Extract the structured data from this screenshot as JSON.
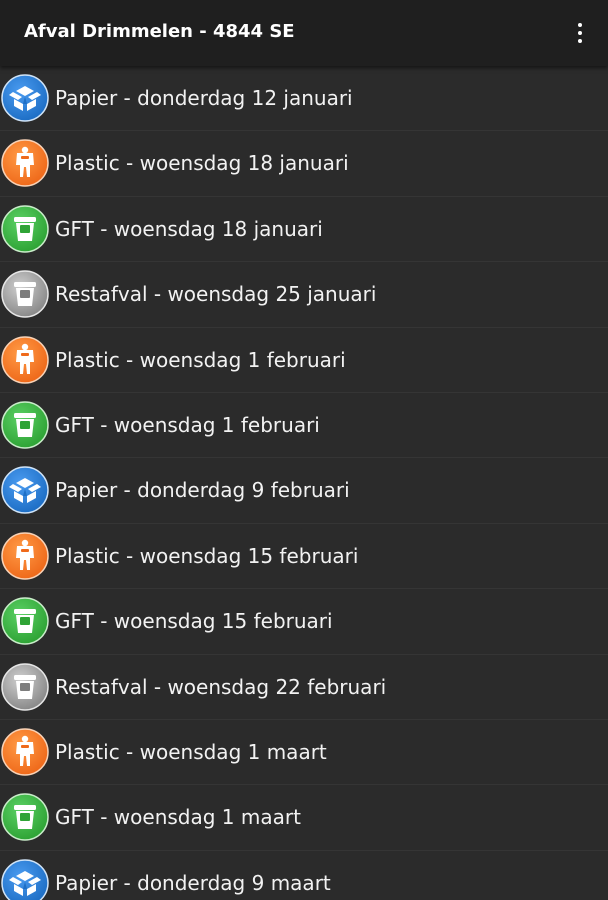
{
  "header": {
    "title": "Afval Drimmelen - 4844 SE"
  },
  "colors": {
    "papier": "#1e6fc6",
    "plastic": "#ef6a1b",
    "gft": "#2fa436",
    "restafval": "#8a8a8a"
  },
  "items": [
    {
      "type": "papier",
      "icon": "box-icon",
      "label": "Papier - donderdag 12 januari"
    },
    {
      "type": "plastic",
      "icon": "plastic-person-icon",
      "label": "Plastic - woensdag 18 januari"
    },
    {
      "type": "gft",
      "icon": "bin-icon",
      "label": "GFT - woensdag 18 januari"
    },
    {
      "type": "restafval",
      "icon": "bin-icon",
      "label": "Restafval - woensdag 25 januari"
    },
    {
      "type": "plastic",
      "icon": "plastic-person-icon",
      "label": "Plastic - woensdag 1 februari"
    },
    {
      "type": "gft",
      "icon": "bin-icon",
      "label": "GFT - woensdag 1 februari"
    },
    {
      "type": "papier",
      "icon": "box-icon",
      "label": "Papier - donderdag 9 februari"
    },
    {
      "type": "plastic",
      "icon": "plastic-person-icon",
      "label": "Plastic - woensdag 15 februari"
    },
    {
      "type": "gft",
      "icon": "bin-icon",
      "label": "GFT - woensdag 15 februari"
    },
    {
      "type": "restafval",
      "icon": "bin-icon",
      "label": "Restafval - woensdag 22 februari"
    },
    {
      "type": "plastic",
      "icon": "plastic-person-icon",
      "label": "Plastic - woensdag 1 maart"
    },
    {
      "type": "gft",
      "icon": "bin-icon",
      "label": "GFT - woensdag 1 maart"
    },
    {
      "type": "papier",
      "icon": "box-icon",
      "label": "Papier - donderdag 9 maart"
    }
  ]
}
